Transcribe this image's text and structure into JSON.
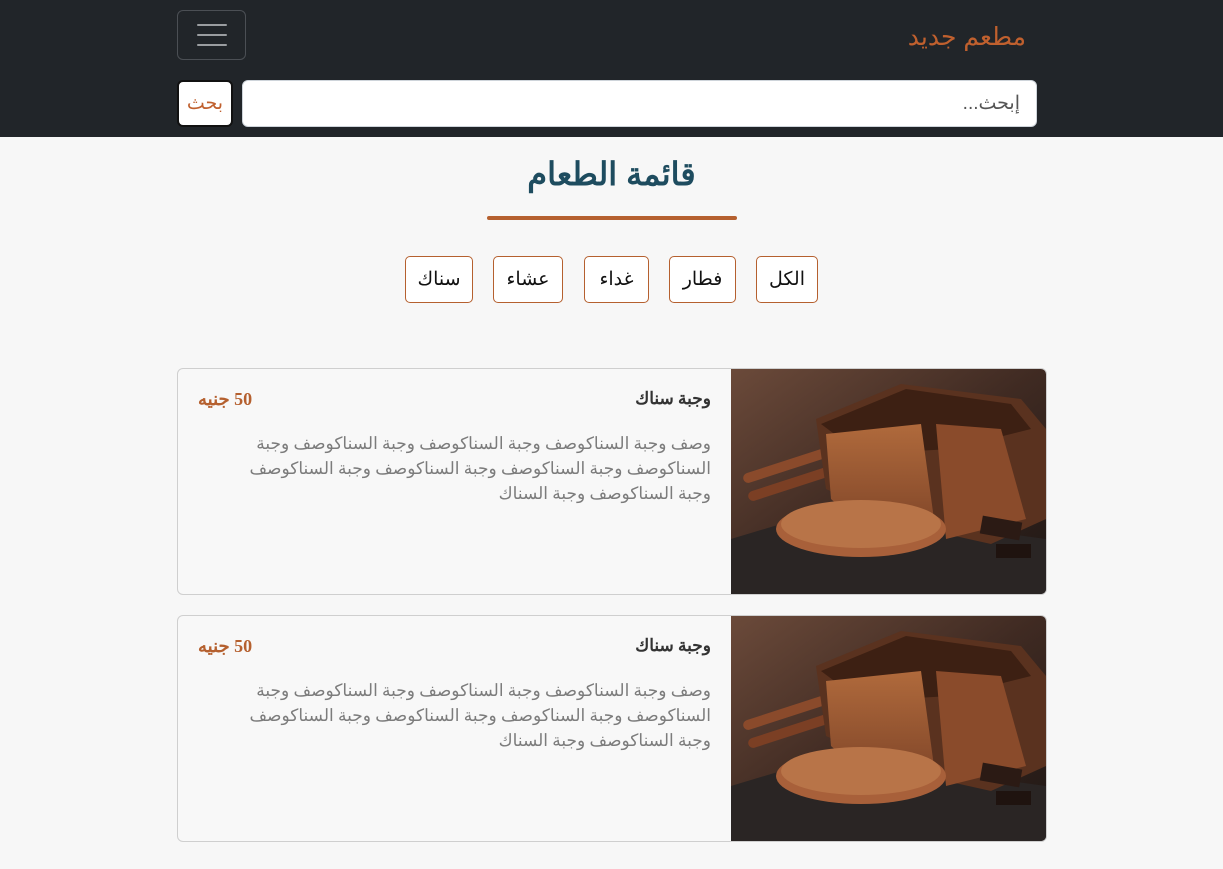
{
  "navbar": {
    "brand": "مطعم جديد",
    "search_placeholder": "إبحث...",
    "search_button": "بحث"
  },
  "menu": {
    "title": "قائمة الطعام",
    "filters": [
      "الكل",
      "فطار",
      "غداء",
      "عشاء",
      "سناك"
    ]
  },
  "colors": {
    "accent": "#b5602f",
    "navbar": "#212529",
    "title": "#1e4c5f"
  },
  "items": [
    {
      "name": "وجبة سناك",
      "price": "50 جنيه",
      "description": "وصف وجبة السناكوصف وجبة السناكوصف وجبة السناكوصف وجبة السناكوصف وجبة السناكوصف وجبة السناكوصف وجبة السناكوصف وجبة السناكوصف وجبة السناك",
      "image": "chocolate-cake-loaf"
    },
    {
      "name": "وجبة سناك",
      "price": "50 جنيه",
      "description": "وصف وجبة السناكوصف وجبة السناكوصف وجبة السناكوصف وجبة السناكوصف وجبة السناكوصف وجبة السناكوصف وجبة السناكوصف وجبة السناكوصف وجبة السناك",
      "image": "chocolate-cake-loaf"
    }
  ]
}
